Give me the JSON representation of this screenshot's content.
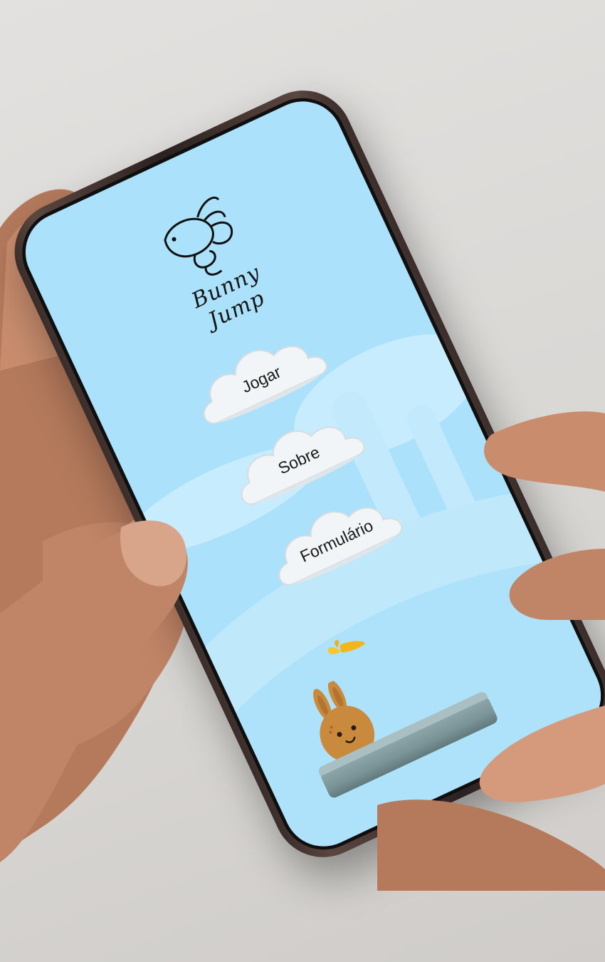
{
  "app": {
    "title": "Bunny Jump"
  },
  "menu": {
    "items": [
      {
        "label": "Jogar"
      },
      {
        "label": "Sobre"
      },
      {
        "label": "Formulário"
      }
    ]
  },
  "colors": {
    "sky": "#abe1fb",
    "cloud_button": "#f1f5f7",
    "bunny": "#c98a3d",
    "carrot": "#f3b51c",
    "platform": "#7a9497",
    "phone_frame": "#3a2d2a"
  },
  "icons": [
    "bunny-logo-icon",
    "carrot-icon",
    "bunny-character-icon"
  ]
}
